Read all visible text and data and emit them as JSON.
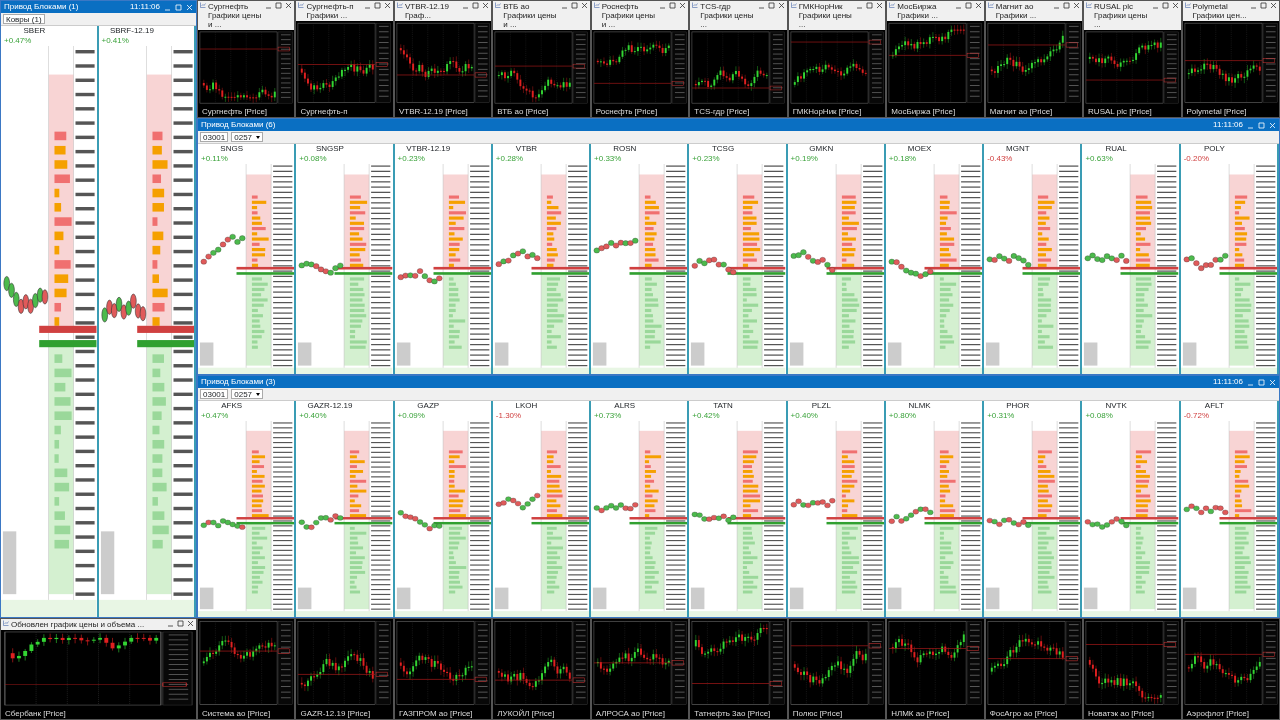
{
  "left_window": {
    "title": "Привод Блоками (1)",
    "time": "11:11:06",
    "account": "Ковры (1)",
    "ladders": [
      {
        "ticker": "SBER",
        "change": "+0.47%",
        "up": true
      },
      {
        "ticker": "SBRF-12.19",
        "change": "+0.41%",
        "up": true
      }
    ]
  },
  "sber_chart": {
    "title": "Обновлен график цены и объема ...",
    "legend": "Сбербанк [Price]"
  },
  "top_charts": [
    {
      "title": "Сургнефть Графики цены и ...",
      "legend": "Сургнефть [Price]"
    },
    {
      "title": "Сургнефть-п Графики ...",
      "legend": "Сургнефть-п"
    },
    {
      "title": "VTBR-12.19 Граф...",
      "legend": "VTBR-12.19 [Price]"
    },
    {
      "title": "ВТБ ао Графики цены и ...",
      "legend": "ВТБ ао [Price]"
    },
    {
      "title": "Роснефть Графики цены и ...",
      "legend": "Роснефть [Price]"
    },
    {
      "title": "TCS-гдр Графики цены ...",
      "legend": "TCS-гдр [Price]"
    },
    {
      "title": "ГМКНорНик Графики цены ...",
      "legend": "ГМКНорНик [Price]"
    },
    {
      "title": "МосБиржа Графики ...",
      "legend": "МосБиржа [Price]"
    },
    {
      "title": "Магнит ао Графики ...",
      "legend": "Магнит ао [Price]"
    },
    {
      "title": "RUSAL plc Графики цены ...",
      "legend": "RUSAL plc [Price]"
    },
    {
      "title": "Polymetal Графики цен...",
      "legend": "Polymetal [Price]"
    }
  ],
  "middle_window": {
    "title": "Привод Блоками (6)",
    "time": "11:11:06",
    "account": "03001",
    "portfolio": "0257",
    "ladders": [
      {
        "ticker": "SNGS",
        "change": "+0.11%",
        "up": true
      },
      {
        "ticker": "SNGSP",
        "change": "+0.08%",
        "up": true
      },
      {
        "ticker": "VTBR-12.19",
        "change": "+0.23%",
        "up": true
      },
      {
        "ticker": "VTBR",
        "change": "+0.28%",
        "up": true
      },
      {
        "ticker": "ROSN",
        "change": "+0.33%",
        "up": true
      },
      {
        "ticker": "TCSG",
        "change": "+0.23%",
        "up": true
      },
      {
        "ticker": "GMKN",
        "change": "+0.19%",
        "up": true
      },
      {
        "ticker": "MOEX",
        "change": "+0.18%",
        "up": true
      },
      {
        "ticker": "MGNT",
        "change": "-0.43%",
        "up": false
      },
      {
        "ticker": "RUAL",
        "change": "+0.63%",
        "up": true
      },
      {
        "ticker": "POLY",
        "change": "-0.20%",
        "up": false
      }
    ]
  },
  "bottom_window": {
    "title": "Привод Блоками (3)",
    "time": "11:11:06",
    "account": "03001",
    "portfolio": "0257",
    "ladders": [
      {
        "ticker": "AFKS",
        "change": "+0.47%",
        "up": true
      },
      {
        "ticker": "GAZR-12.19",
        "change": "+0.40%",
        "up": true
      },
      {
        "ticker": "GAZP",
        "change": "+0.09%",
        "up": true
      },
      {
        "ticker": "LKOH",
        "change": "-1.30%",
        "up": false
      },
      {
        "ticker": "ALRS",
        "change": "+0.73%",
        "up": true
      },
      {
        "ticker": "TATN",
        "change": "+0.42%",
        "up": true
      },
      {
        "ticker": "PLZL",
        "change": "+0.40%",
        "up": true
      },
      {
        "ticker": "NLMK",
        "change": "+0.80%",
        "up": true
      },
      {
        "ticker": "PHOR",
        "change": "+0.31%",
        "up": true
      },
      {
        "ticker": "NVTK",
        "change": "+0.08%",
        "up": true
      },
      {
        "ticker": "AFLT",
        "change": "-0.72%",
        "up": false
      }
    ]
  },
  "bottom_charts": [
    {
      "legend": "Система ао [Price]"
    },
    {
      "legend": "GAZR-12.19 [Price]"
    },
    {
      "legend": "ГАЗПРОМ ао [Price]"
    },
    {
      "legend": "ЛУКОЙЛ [Price]"
    },
    {
      "legend": "АЛРОСА ао [Price]"
    },
    {
      "legend": "Татнефть 3ао [Price]"
    },
    {
      "legend": "Полюс [Price]"
    },
    {
      "legend": "НЛМК ао [Price]"
    },
    {
      "legend": "ФосАгро ао [Price]"
    },
    {
      "legend": "Новатэк ао [Price]"
    },
    {
      "legend": "Аэрофлот [Price]"
    }
  ]
}
